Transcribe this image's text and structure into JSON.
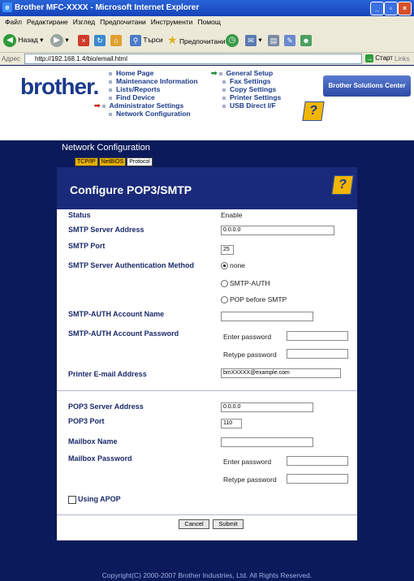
{
  "window": {
    "title": "Brother MFC-XXXX - Microsoft Internet Explorer"
  },
  "menu": [
    "Файл",
    "Редактиране",
    "Изглед",
    "Предпочитани",
    "Инструменти",
    "Помощ"
  ],
  "toolbar": {
    "back_label": "Назад",
    "search_label": "Търси",
    "favorites_label": "Предпочитани"
  },
  "address": {
    "label": "Адрес",
    "url": "http://192.168.1.4/bio/email.html",
    "go_label": "Старт",
    "links_label": "Links"
  },
  "header": {
    "logo": "brother.",
    "nav_left": [
      "Home Page",
      "Maintenance Information",
      "Lists/Reports",
      "Find Device",
      "Administrator Settings",
      "Network Configuration"
    ],
    "nav_right": [
      "General Setup",
      "Fax Settings",
      "Copy Settings",
      "Printer Settings",
      "USB Direct I/F"
    ],
    "solutions_label": "Brother Solutions Center"
  },
  "section": {
    "title": "Network Configuration",
    "tabs": [
      "TCP/IP",
      "NetBIOS",
      "Protocol"
    ]
  },
  "panel": {
    "title": "Configure POP3/SMTP",
    "status_label": "Status",
    "status_value": "Enable",
    "smtp_server_label": "SMTP Server Address",
    "smtp_server_value": "0.0.0.0",
    "smtp_port_label": "SMTP Port",
    "smtp_port_value": "25",
    "smtp_auth_label": "SMTP Server Authentication Method",
    "auth_options": [
      "none",
      "SMTP-AUTH",
      "POP before SMTP"
    ],
    "smtp_account_label": "SMTP-AUTH Account Name",
    "smtp_account_value": "",
    "smtp_password_label": "SMTP-AUTH Account Password",
    "enter_password": "Enter password",
    "retype_password": "Retype password",
    "email_label": "Printer E-mail Address",
    "email_value": "bmXXXXX@example.com",
    "pop3_server_label": "POP3 Server Address",
    "pop3_server_value": "0.0.0.0",
    "pop3_port_label": "POP3 Port",
    "pop3_port_value": "110",
    "mailbox_name_label": "Mailbox Name",
    "mailbox_name_value": "",
    "mailbox_password_label": "Mailbox Password",
    "apop_label": "Using APOP",
    "cancel_label": "Cancel",
    "submit_label": "Submit"
  },
  "footer": "Copyright(C) 2000-2007 Brother Industries, Ltd. All Rights Reserved.",
  "colors": {
    "page_bg": "#0b1a5a",
    "panel_header": "#1a2a7a",
    "label_text": "#1a2a6a",
    "help_icon": "#f2b600"
  }
}
